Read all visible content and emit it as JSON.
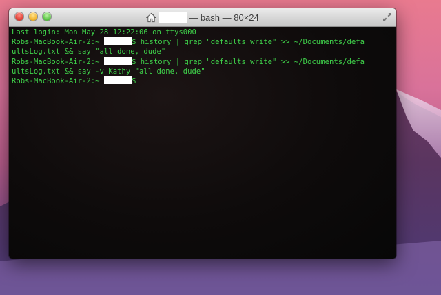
{
  "window": {
    "title": "— bash — 80×24",
    "icons": {
      "home": "house-icon",
      "fullscreen": "fullscreen-arrows-icon"
    }
  },
  "terminal": {
    "lines": [
      {
        "text": "Last login: Mon May 28 12:22:06 on ttys000"
      },
      {
        "prefix": "Robs-MacBook-Air-2:~ ",
        "redacted": true,
        "suffix": "$ history | grep \"defaults write\" >> ~/Documents/defa"
      },
      {
        "text": "ultsLog.txt && say \"all done, dude\""
      },
      {
        "prefix": "Robs-MacBook-Air-2:~ ",
        "redacted": true,
        "suffix": "$ history | grep \"defaults write\" >> ~/Documents/defa"
      },
      {
        "text": "ultsLog.txt && say -v Kathy \"all done, dude\""
      },
      {
        "prefix": "Robs-MacBook-Air-2:~ ",
        "redacted": true,
        "suffix": "$"
      }
    ],
    "text_color": "#3fd14a",
    "background_color": "#0b0b0b"
  }
}
